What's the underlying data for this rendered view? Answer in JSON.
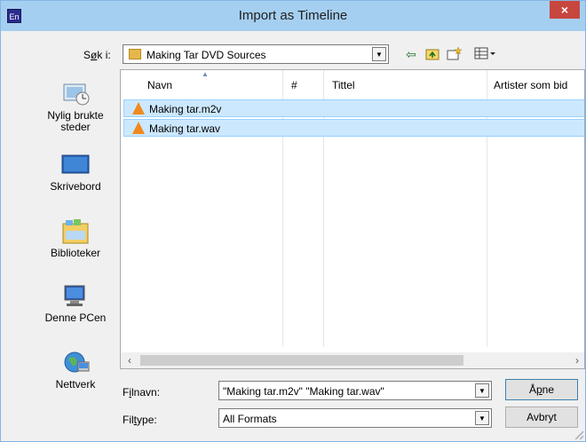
{
  "window": {
    "app_icon_text": "En",
    "title": "Import as Timeline",
    "close_symbol": "×"
  },
  "look_in": {
    "label_prefix": "S",
    "label_underlined": "ø",
    "label_suffix": "k i:",
    "value": "Making Tar DVD Sources"
  },
  "toolbar": {
    "back_icon": "back-arrow-icon",
    "up_icon": "up-folder-icon",
    "new_folder_icon": "new-folder-icon",
    "view_icon": "view-menu-icon"
  },
  "sidebar": {
    "items": [
      {
        "label": "Nylig brukte steder",
        "icon": "recent-places-icon"
      },
      {
        "label": "Skrivebord",
        "icon": "desktop-icon"
      },
      {
        "label": "Biblioteker",
        "icon": "libraries-icon"
      },
      {
        "label": "Denne PCen",
        "icon": "computer-icon"
      },
      {
        "label": "Nettverk",
        "icon": "network-icon"
      }
    ]
  },
  "columns": [
    "Navn",
    "#",
    "Tittel",
    "Artister som bid"
  ],
  "files": [
    {
      "name": "Making tar.m2v",
      "icon": "vlc-file-icon",
      "selected": true
    },
    {
      "name": "Making tar.wav",
      "icon": "vlc-file-icon",
      "selected": true
    }
  ],
  "filename": {
    "label_prefix": "F",
    "label_underlined": "i",
    "label_suffix": "lnavn:",
    "value": "\"Making tar.m2v\" \"Making tar.wav\""
  },
  "filetype": {
    "label_prefix": "Fil",
    "label_underlined": "t",
    "label_suffix": "ype:",
    "value": "All Formats"
  },
  "buttons": {
    "open_prefix": "Å",
    "open_underlined": "p",
    "open_suffix": "ne",
    "cancel": "Avbryt"
  },
  "colors": {
    "titlebar": "#a5cff0",
    "close": "#c7463e",
    "selection": "#cce8ff"
  }
}
